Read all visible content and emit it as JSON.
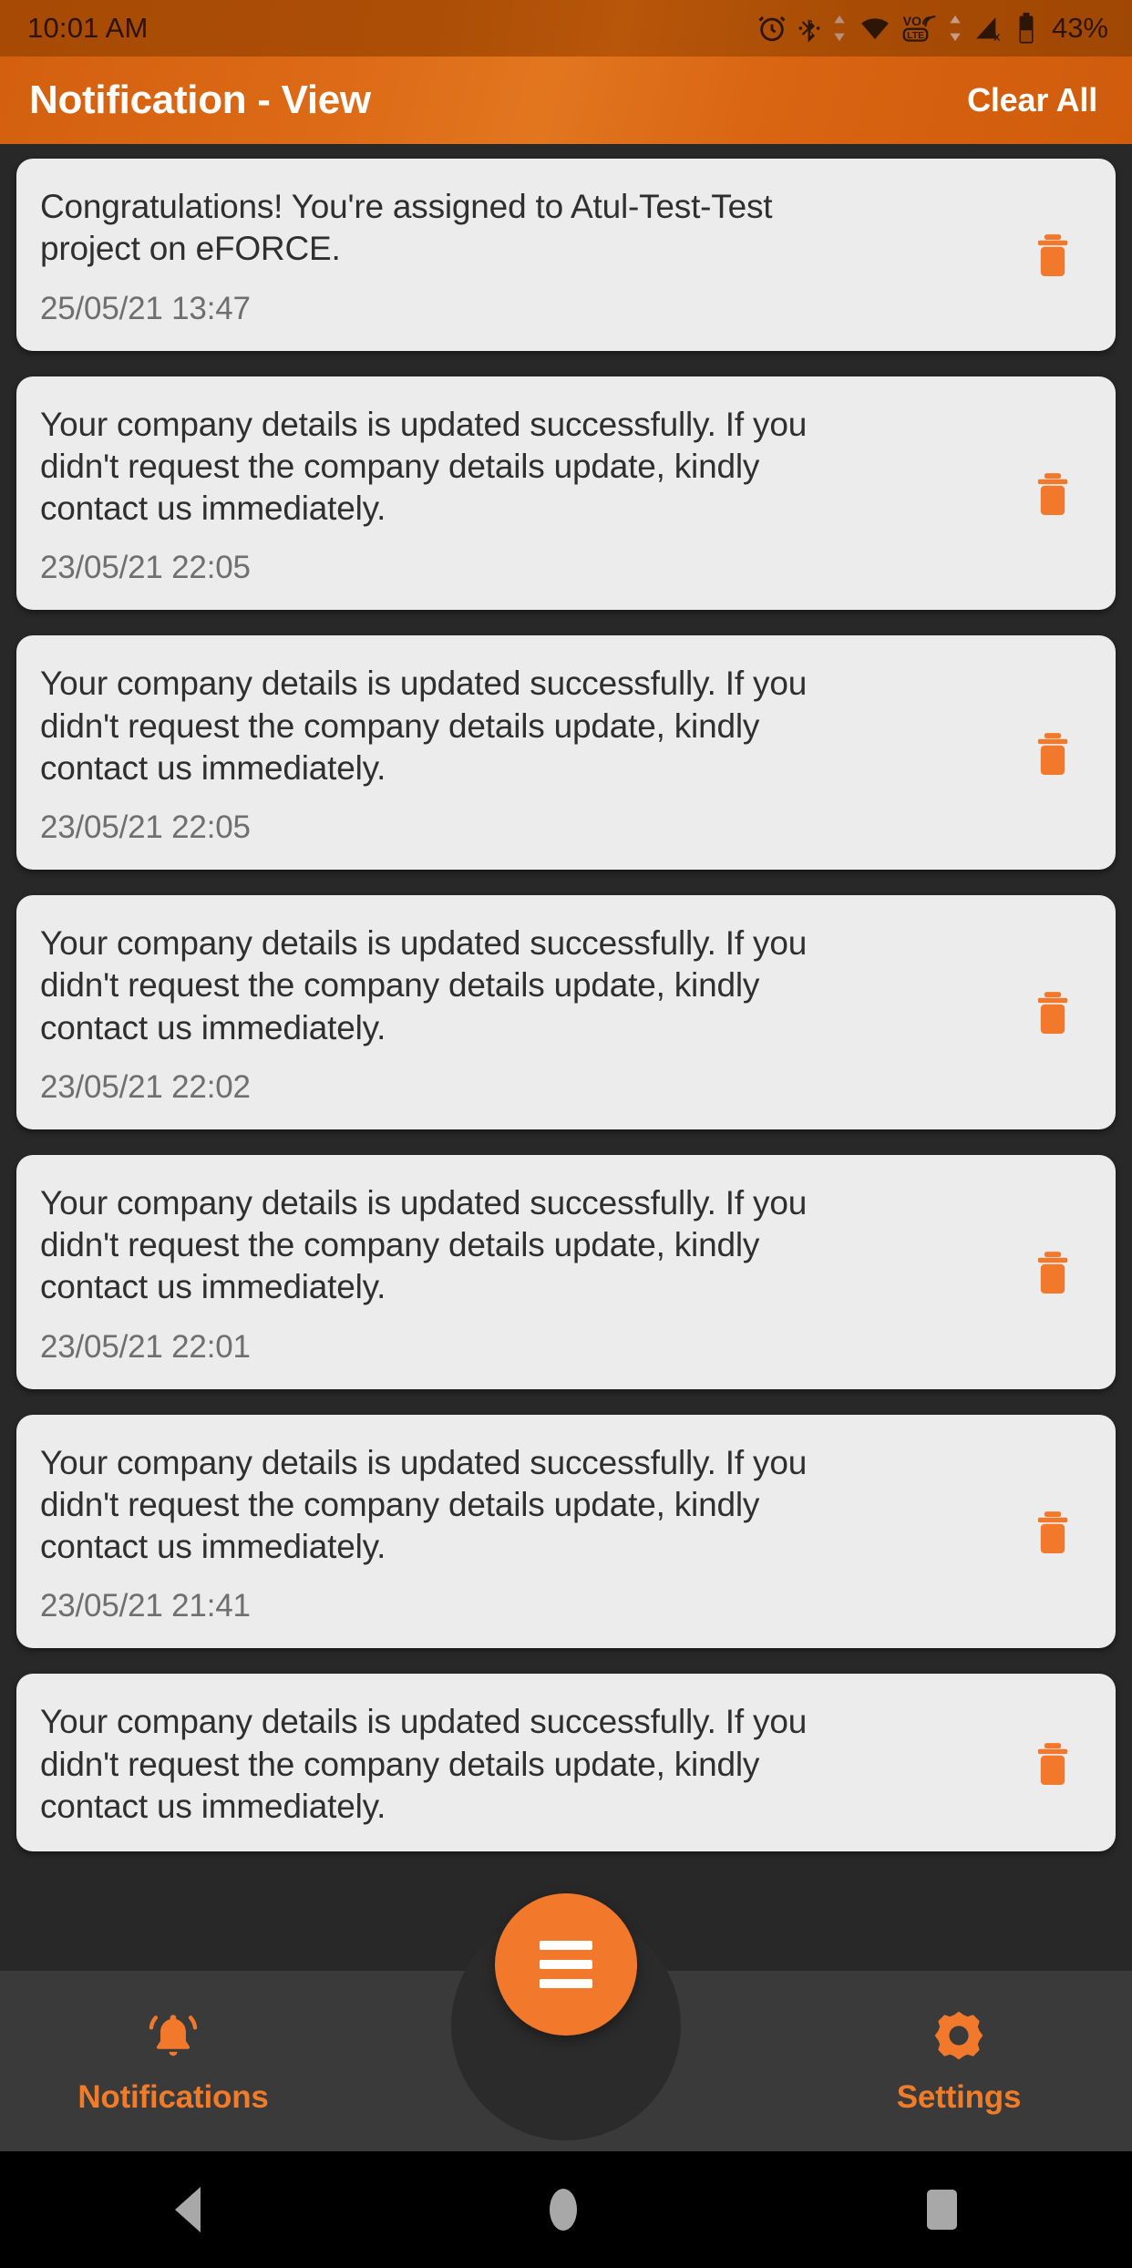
{
  "status_bar": {
    "time": "10:01 AM",
    "battery_percent": "43%",
    "icons": [
      "alarm-icon",
      "bluetooth-icon",
      "bluetooth-data-arrows-icon",
      "wifi-icon",
      "volte-icon",
      "mobile-data-arrows-icon",
      "cellular-signal-off-icon",
      "battery-icon"
    ]
  },
  "app_bar": {
    "title": "Notification - View",
    "clear_all_label": "Clear All"
  },
  "notifications": [
    {
      "message": "Congratulations! You're assigned to Atul-Test-Test project on eFORCE.",
      "timestamp": "25/05/21 13:47"
    },
    {
      "message": "Your company details is updated successfully. If you didn't request the company details update, kindly contact us immediately.",
      "timestamp": "23/05/21 22:05"
    },
    {
      "message": "Your company details is updated successfully. If you didn't request the company details update, kindly contact us immediately.",
      "timestamp": "23/05/21 22:05"
    },
    {
      "message": "Your company details is updated successfully. If you didn't request the company details update, kindly contact us immediately.",
      "timestamp": "23/05/21 22:02"
    },
    {
      "message": "Your company details is updated successfully. If you didn't request the company details update, kindly contact us immediately.",
      "timestamp": "23/05/21 22:01"
    },
    {
      "message": "Your company details is updated successfully. If you didn't request the company details update, kindly contact us immediately.",
      "timestamp": "23/05/21 21:41"
    },
    {
      "message": "Your company details is updated successfully. If you didn't request the company details update, kindly contact us immediately.",
      "timestamp": ""
    }
  ],
  "bottom_nav": {
    "items": [
      {
        "label": "Notifications",
        "icon": "bell-icon",
        "active": true
      },
      {
        "label": "Settings",
        "icon": "gear-icon",
        "active": false
      }
    ],
    "fab_icon": "hamburger-menu-icon"
  },
  "android_nav": {
    "back": "back-icon",
    "home": "home-icon",
    "recents": "recents-icon"
  },
  "colors": {
    "accent": "#f2792b",
    "app_bar": "#da6418",
    "status_bar": "#a64a05",
    "background": "#282828",
    "card": "#ececec",
    "nav_bar": "#3a3a3a"
  }
}
